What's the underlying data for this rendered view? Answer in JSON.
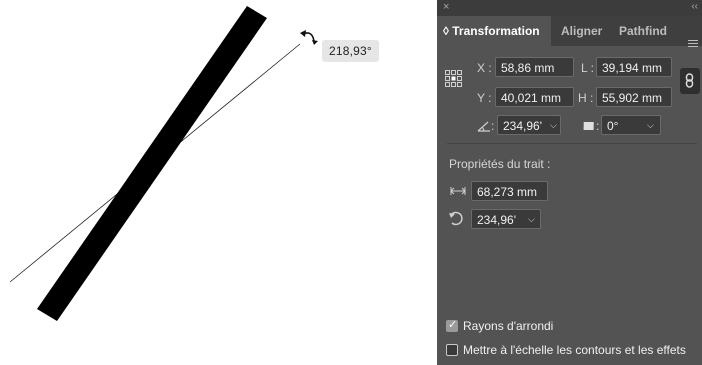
{
  "canvas": {
    "rotation_tooltip": "218,93°"
  },
  "panel": {
    "tabs": [
      "◊ Transformation",
      "Aligner",
      "Pathfind"
    ],
    "fields": {
      "x_label": "X :",
      "x_value": "58,86 mm",
      "y_label": "Y :",
      "y_value": "40,021 mm",
      "l_label": "L :",
      "l_value": "39,194 mm",
      "h_label": "H :",
      "h_value": "55,902 mm",
      "angle_label": ":",
      "angle_value": "234,96'",
      "shear_label": ":",
      "shear_value": "0°"
    },
    "stroke": {
      "section_title": "Propriétés du trait :",
      "length_value": "68,273 mm",
      "rotation_value": "234,96'"
    },
    "options": {
      "corner_label": "Rayons d'arrondi",
      "corner_checked": true,
      "scale_label": "Mettre à l'échelle les contours et les effets",
      "scale_checked": false
    }
  }
}
